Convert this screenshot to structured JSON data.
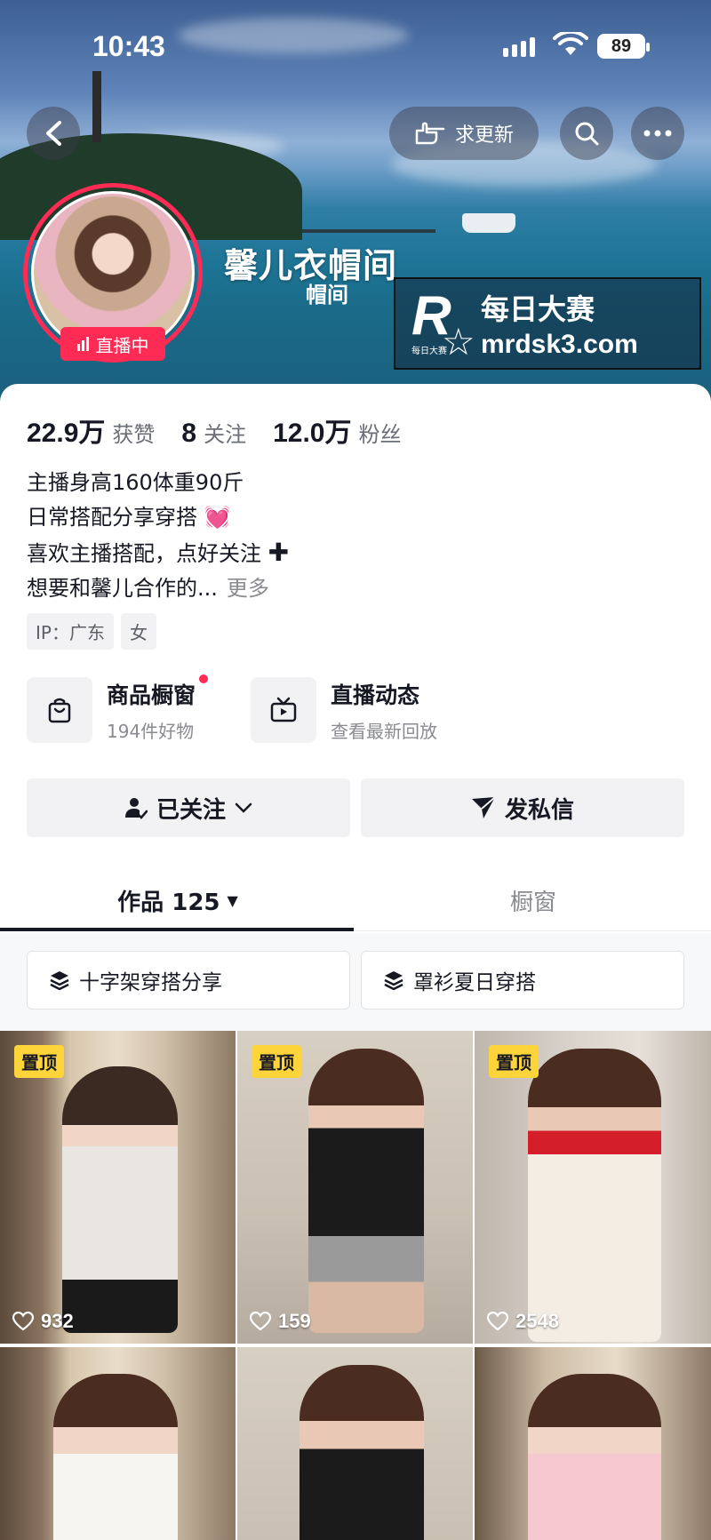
{
  "status_bar": {
    "time": "10:43",
    "battery": "89"
  },
  "header": {
    "request_update_label": "求更新",
    "shop_name": "馨儿衣帽间",
    "shop_subtitle": "帽间",
    "live_badge": "直播中"
  },
  "watermark": {
    "brand_cn": "每日大赛",
    "brand_small": "每日大赛",
    "url": "mrdsk3.com"
  },
  "stats": [
    {
      "value": "22.9万",
      "label": "获赞"
    },
    {
      "value": "8",
      "label": "关注"
    },
    {
      "value": "12.0万",
      "label": "粉丝"
    }
  ],
  "bio": {
    "line1": "主播身高160体重90斤",
    "line2": "日常搭配分享穿搭",
    "line3": "喜欢主播搭配，点好关注",
    "line4": "想要和馨儿合作的...",
    "more": "更多"
  },
  "tags": [
    "IP：广东",
    "女"
  ],
  "features": [
    {
      "title": "商品橱窗",
      "subtitle": "194件好物"
    },
    {
      "title": "直播动态",
      "subtitle": "查看最新回放"
    }
  ],
  "actions": {
    "follow": "已关注",
    "message": "发私信"
  },
  "tabs": [
    {
      "label": "作品 125"
    },
    {
      "label": "橱窗"
    }
  ],
  "collections": [
    "十字架穿搭分享",
    "罩衫夏日穿搭"
  ],
  "videos": [
    {
      "pinned": "置顶",
      "likes": "932"
    },
    {
      "pinned": "置顶",
      "likes": "159"
    },
    {
      "pinned": "置顶",
      "likes": "2548"
    },
    {
      "pinned": "",
      "likes": ""
    },
    {
      "pinned": "",
      "likes": ""
    },
    {
      "pinned": "",
      "likes": ""
    }
  ],
  "colors": {
    "accent": "#fe2c55",
    "pin": "#fdd53a",
    "text": "#161823",
    "muted": "#8a8b91"
  }
}
